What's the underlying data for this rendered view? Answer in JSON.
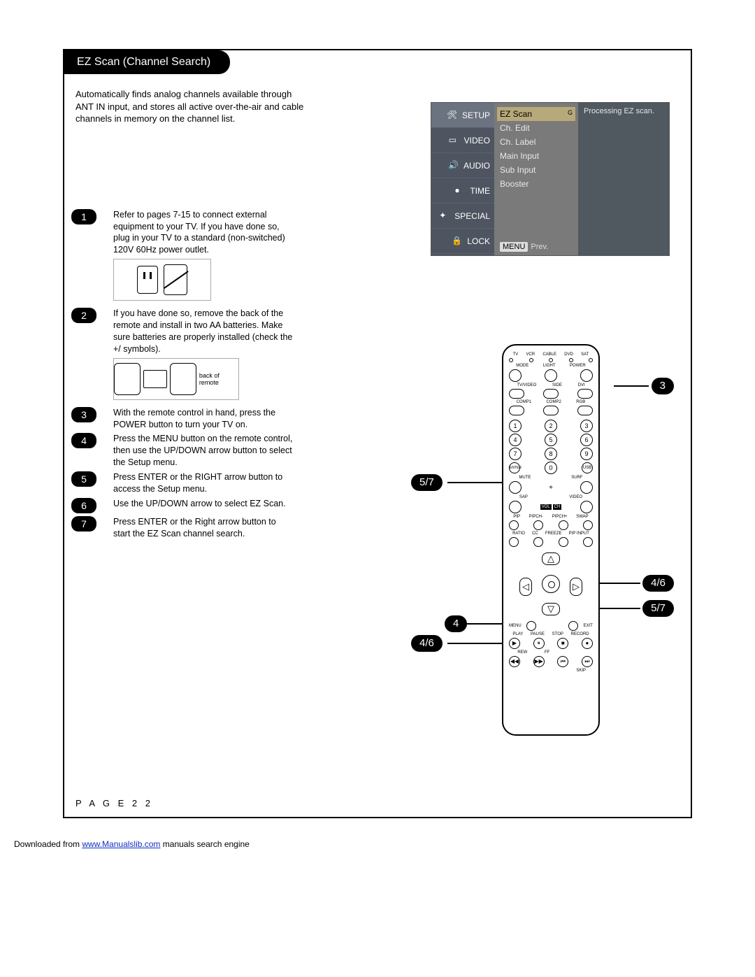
{
  "title": "EZ Scan (Channel Search)",
  "intro": "Automatically finds analog channels available through ANT IN input, and stores all active over-the-air and cable channels in memory on the channel list.",
  "osd": {
    "tabs": [
      "SETUP",
      "VIDEO",
      "AUDIO",
      "TIME",
      "SPECIAL",
      "LOCK"
    ],
    "items": [
      "EZ Scan",
      "Ch. Edit",
      "Ch. Label",
      "Main Input",
      "Sub Input",
      "Booster"
    ],
    "menu_prev": {
      "menu": "MENU",
      "prev": "Prev."
    },
    "right": {
      "g": "G",
      "msg": "Processing EZ scan."
    }
  },
  "steps": [
    {
      "n": "1",
      "text": "Refer to pages 7-15 to connect external equipment to your TV. If you have done so, plug in your TV to a standard (non-switched) 120V 60Hz power outlet."
    },
    {
      "n": "2",
      "text": "If you have done so, remove the back of the remote and install in two AA batteries. Make sure batteries are properly installed (check the +/  symbols)."
    },
    {
      "n": "3",
      "text": "With the remote control in hand, press the POWER button to turn your TV on."
    },
    {
      "n": "4",
      "text": "Press the MENU button on the remote control, then use the UP/DOWN arrow button to select the Setup menu."
    },
    {
      "n": "5",
      "text": "Press ENTER or the RIGHT arrow button to access the Setup menu."
    },
    {
      "n": "6",
      "text": "Use the UP/DOWN arrow to select EZ Scan."
    },
    {
      "n": "7",
      "text": "Press ENTER or the Right arrow button to start the EZ Scan channel search."
    }
  ],
  "battery_label": "back of remote",
  "remote": {
    "top_labels": [
      "TV",
      "VCR",
      "CABLE",
      "DVD",
      "SAT"
    ],
    "mode_row": [
      "MODE",
      "LIGHT",
      "POWER"
    ],
    "input_row1": [
      "TV/VIDEO",
      "SIDE",
      "DVI"
    ],
    "input_row2": [
      "COMP1",
      "COMP2",
      "RGB"
    ],
    "numpad": [
      "1",
      "2",
      "3",
      "4",
      "5",
      "6",
      "7",
      "8",
      "9"
    ],
    "bottom_num_row": [
      "ENTER",
      "0",
      "USB"
    ],
    "mute_surf": [
      "MUTE",
      "SURF"
    ],
    "sap_video": [
      "SAP",
      "VIDEO"
    ],
    "vol_ch": [
      "VOL",
      "CH"
    ],
    "pip_row": [
      "PIP",
      "PIPCH-",
      "PIPCH+",
      "SWAP"
    ],
    "ratio_row": [
      "RATIO",
      "CC",
      "FREEZE",
      "PIP INPUT"
    ],
    "nav_labels": [
      "MENU",
      "EXIT"
    ],
    "transport1": [
      "PLAY",
      "PAUSE",
      "STOP",
      "RECORD"
    ],
    "transport2": [
      "REW",
      "FF"
    ],
    "skip": "SKIP"
  },
  "callouts": {
    "c3": "3",
    "c57a": "5/7",
    "c4a": "4",
    "c46a": "4/6",
    "c46b": "4/6",
    "c57b": "5/7"
  },
  "page_number": "P A G E  2 2",
  "footer": {
    "pre": "Downloaded from ",
    "link": "www.Manualslib.com",
    "post": " manuals search engine"
  }
}
